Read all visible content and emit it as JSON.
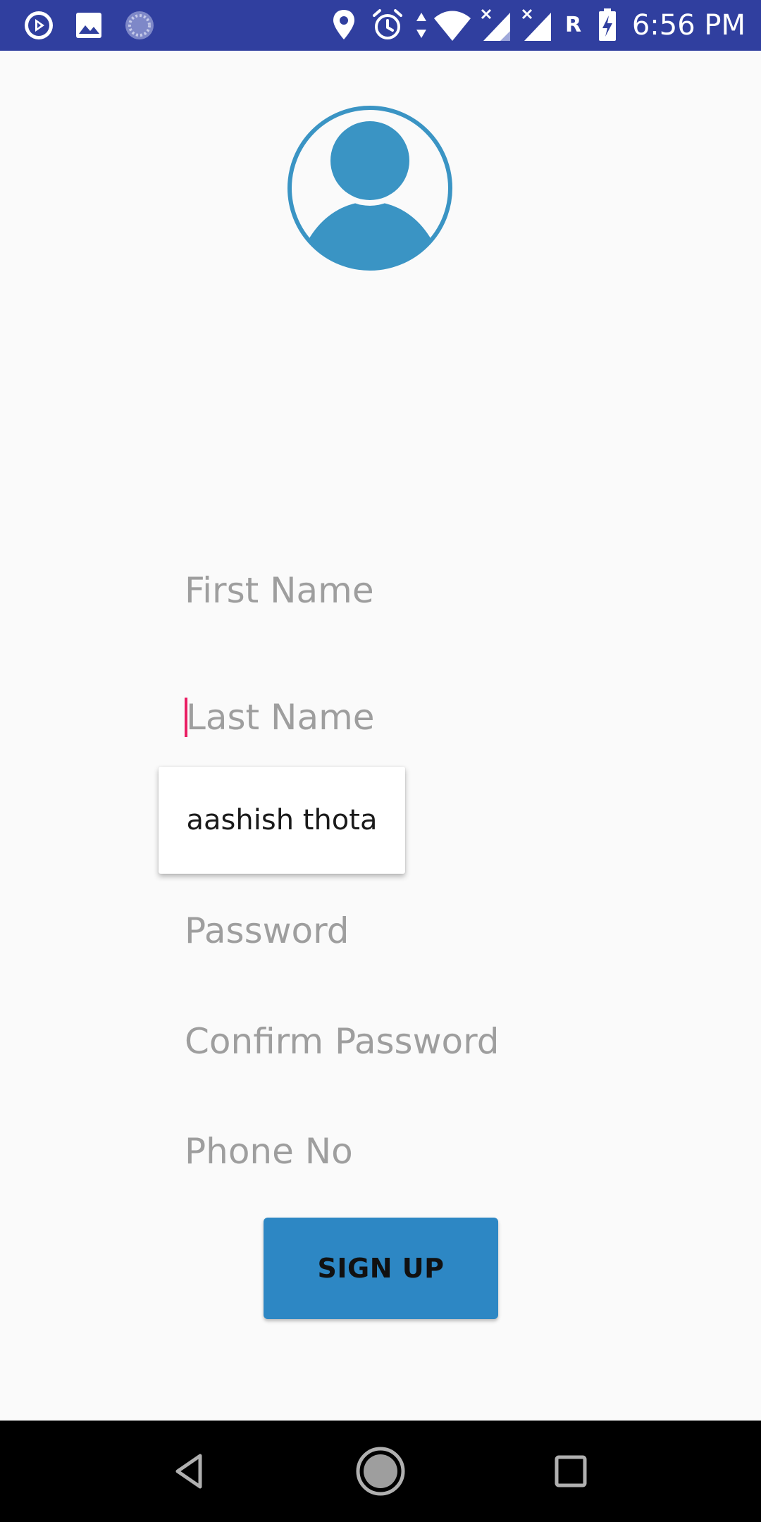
{
  "status_bar": {
    "time": "6:56 PM",
    "icons": [
      "play-store-notification-icon",
      "gallery-notification-icon",
      "sync-notification-icon",
      "location-icon",
      "alarm-icon",
      "data-transfer-icon",
      "wifi-icon",
      "signal-icon-1",
      "signal-icon-2",
      "roaming-icon",
      "battery-charging-icon"
    ],
    "roaming_label": "R",
    "background": "#303f9f"
  },
  "avatar": {
    "icon": "user-avatar-icon",
    "color": "#3a94c4"
  },
  "form": {
    "fields": [
      {
        "name": "first-name",
        "placeholder": "First Name",
        "value": ""
      },
      {
        "name": "last-name",
        "placeholder": "Last Name",
        "value": "",
        "focused": true
      },
      {
        "name": "password",
        "placeholder": "Password",
        "value": ""
      },
      {
        "name": "confirm-password",
        "placeholder": "Confirm Password",
        "value": ""
      },
      {
        "name": "phone-no",
        "placeholder": "Phone No",
        "value": ""
      }
    ],
    "caret_color": "#e91e63"
  },
  "autocomplete": {
    "suggestion": "aashish thota"
  },
  "signup_button": {
    "label": "SIGN UP",
    "color": "#2d87c4"
  },
  "nav_bar": {
    "buttons": [
      "back-icon",
      "home-icon",
      "recents-icon"
    ]
  }
}
